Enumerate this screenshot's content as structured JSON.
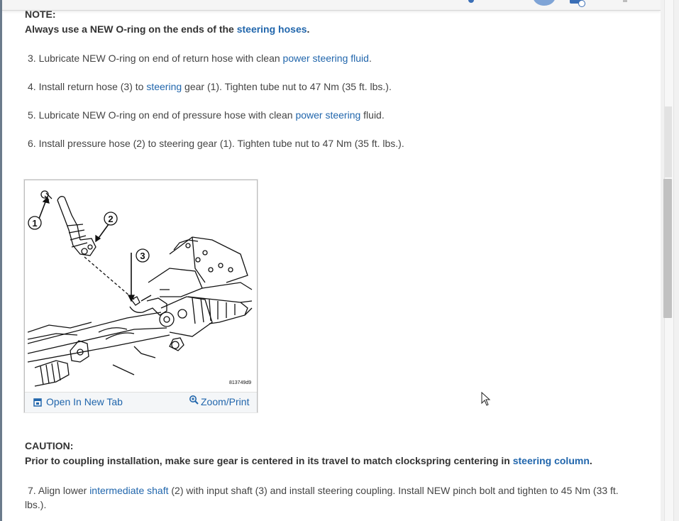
{
  "note": {
    "label": "NOTE:",
    "text_before": "Always use a NEW O-ring on the ends of the ",
    "link": "steering hoses",
    "text_after": "."
  },
  "steps": [
    {
      "num": "3.",
      "before": "Lubricate NEW O-ring on end of return hose with clean ",
      "link": "power steering fluid",
      "after": "."
    },
    {
      "num": "4.",
      "before": "Install return hose (3) to ",
      "link": "steering",
      "after": " gear (1). Tighten tube nut to 47 Nm (35 ft. lbs.)."
    },
    {
      "num": "5.",
      "before": "Lubricate NEW O-ring on end of pressure hose with clean ",
      "link": "power steering",
      "after": " fluid."
    },
    {
      "num": "6.",
      "before": "Install pressure hose (2) to steering gear (1). Tighten tube nut to 47 Nm (35 ft. lbs.).",
      "link": "",
      "after": ""
    }
  ],
  "figure": {
    "callouts": [
      "1",
      "2",
      "3"
    ],
    "code": "813749d9",
    "open_label": "Open In New Tab",
    "zoom_label": "Zoom/Print",
    "open_icon": "open-tab-icon",
    "zoom_icon": "magnifier-icon"
  },
  "caution": {
    "label": "CAUTION:",
    "text_before": "Prior to coupling installation, make sure gear is centered in its travel to match clockspring centering in ",
    "link": "steering column",
    "text_after": "."
  },
  "step7": {
    "num": "7.",
    "before": "Align lower ",
    "link": "intermediate shaft",
    "after": " (2) with input shaft (3) and install steering coupling. Install NEW pinch bolt and tighten to 45 Nm (33 ft. lbs.)."
  },
  "colors": {
    "link": "#2166ac",
    "text": "#444444",
    "accent": "#3b6fb6"
  }
}
